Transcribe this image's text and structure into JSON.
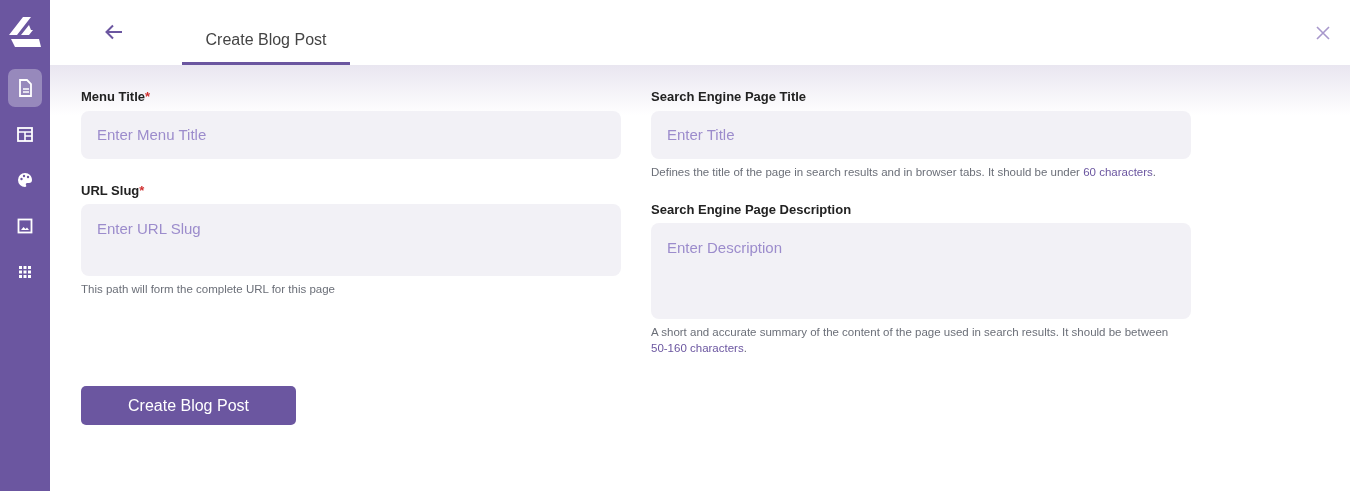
{
  "sidebar": {
    "items": [
      {
        "kind": "document",
        "selected": true
      },
      {
        "kind": "layout",
        "selected": false
      },
      {
        "kind": "palette",
        "selected": false
      },
      {
        "kind": "image",
        "selected": false
      },
      {
        "kind": "apps",
        "selected": false
      }
    ]
  },
  "header": {
    "tabs": [
      {
        "label": "Create Blog Post",
        "selected": true
      }
    ]
  },
  "left_fields": [
    {
      "label": "Menu Title",
      "required_mark": "*",
      "placeholder": "Enter Menu Title",
      "kind": "input"
    },
    {
      "label": "URL Slug",
      "required_mark": "*",
      "placeholder": "Enter URL Slug",
      "kind": "textarea",
      "help": {
        "text": "This path will form the complete URL for this page"
      }
    }
  ],
  "right_fields": [
    {
      "label": "Search Engine Page Title",
      "placeholder": "Enter Title",
      "kind": "input",
      "help": {
        "text": "Defines the title of the page in search results and in browser tabs. It should be under ",
        "highlight": "60 characters",
        "end": "."
      }
    },
    {
      "label": "Search Engine Page Description",
      "placeholder": "Enter Description",
      "kind": "textarea_large",
      "help": {
        "text": "A short and accurate summary of the content of the page used in search results. It should be between ",
        "highlight": "50-160 characters",
        "end": "."
      }
    }
  ],
  "submit_button": "Create Blog Post"
}
